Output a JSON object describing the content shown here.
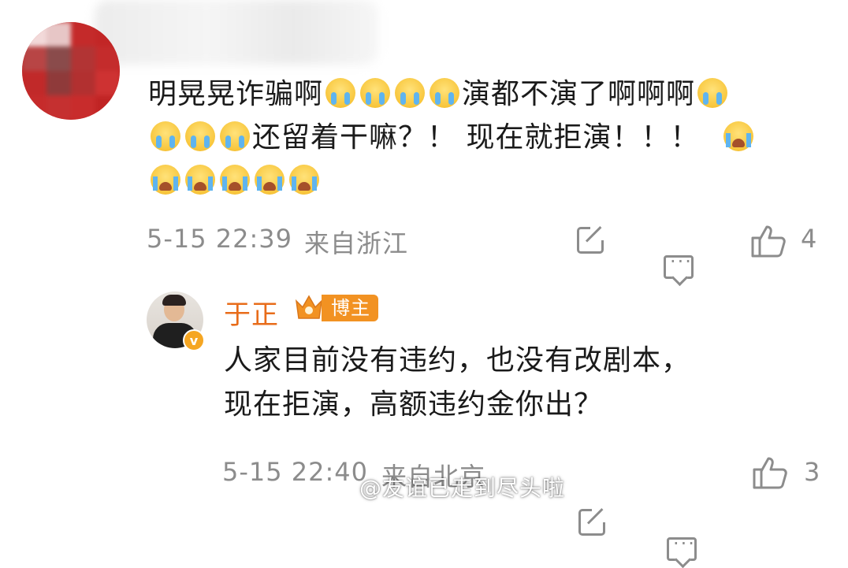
{
  "comment1": {
    "text_parts": [
      "明晃晃诈骗啊",
      "演都不演了啊啊啊",
      "还留着干嘛？！ 现在就拒演！！！"
    ],
    "timestamp": "5-15 22:39",
    "location": "来自浙江",
    "like_count": "4"
  },
  "reply": {
    "author": "于正",
    "badge": "博主",
    "verified_mark": "v",
    "text_line1": "人家目前没有违约，也没有改剧本，",
    "text_line2": "现在拒演，高额违约金你出？",
    "timestamp": "5-15 22:40",
    "location": "来自北京",
    "like_count": "3"
  },
  "watermark": "@友谊已走到尽头啦",
  "icons": [
    "share-icon",
    "comment-icon",
    "like-icon",
    "crown-icon",
    "weibo-logo-icon"
  ],
  "colors": {
    "author": "#e86c1a",
    "badge": "#f29222",
    "meta": "#8c8c8c"
  }
}
